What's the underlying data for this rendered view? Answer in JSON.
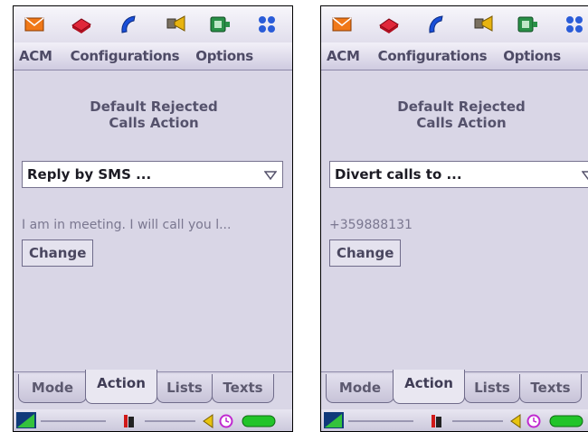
{
  "screens": [
    {
      "menu": [
        "ACM",
        "Configurations",
        "Options"
      ],
      "heading_line1": "Default Rejected",
      "heading_line2": "Calls Action",
      "dropdown_value": "Reply by SMS ...",
      "detail_text": "I am in meeting. I will call you l...",
      "button_label": "Change",
      "tabs": [
        "Mode",
        "Action",
        "Lists",
        "Texts"
      ],
      "active_tab": "Action"
    },
    {
      "menu": [
        "ACM",
        "Configurations",
        "Options"
      ],
      "heading_line1": "Default Rejected",
      "heading_line2": "Calls Action",
      "dropdown_value": "Divert calls to ...",
      "detail_text": "+359888131",
      "button_label": "Change",
      "tabs": [
        "Mode",
        "Action",
        "Lists",
        "Texts"
      ],
      "active_tab": "Action"
    }
  ],
  "app_icons": [
    "envelope-icon",
    "book-icon",
    "phone-handset-icon",
    "gramophone-icon",
    "media-icon",
    "apps-grid-icon"
  ],
  "status_icons": [
    "signal-icon",
    "bluetooth-icon",
    "speaker-icon",
    "clock-icon",
    "battery-icon"
  ],
  "colors": {
    "screen_bg": "#d9d6e6",
    "menu_text": "#4e4b66",
    "battery": "#22c42a"
  }
}
